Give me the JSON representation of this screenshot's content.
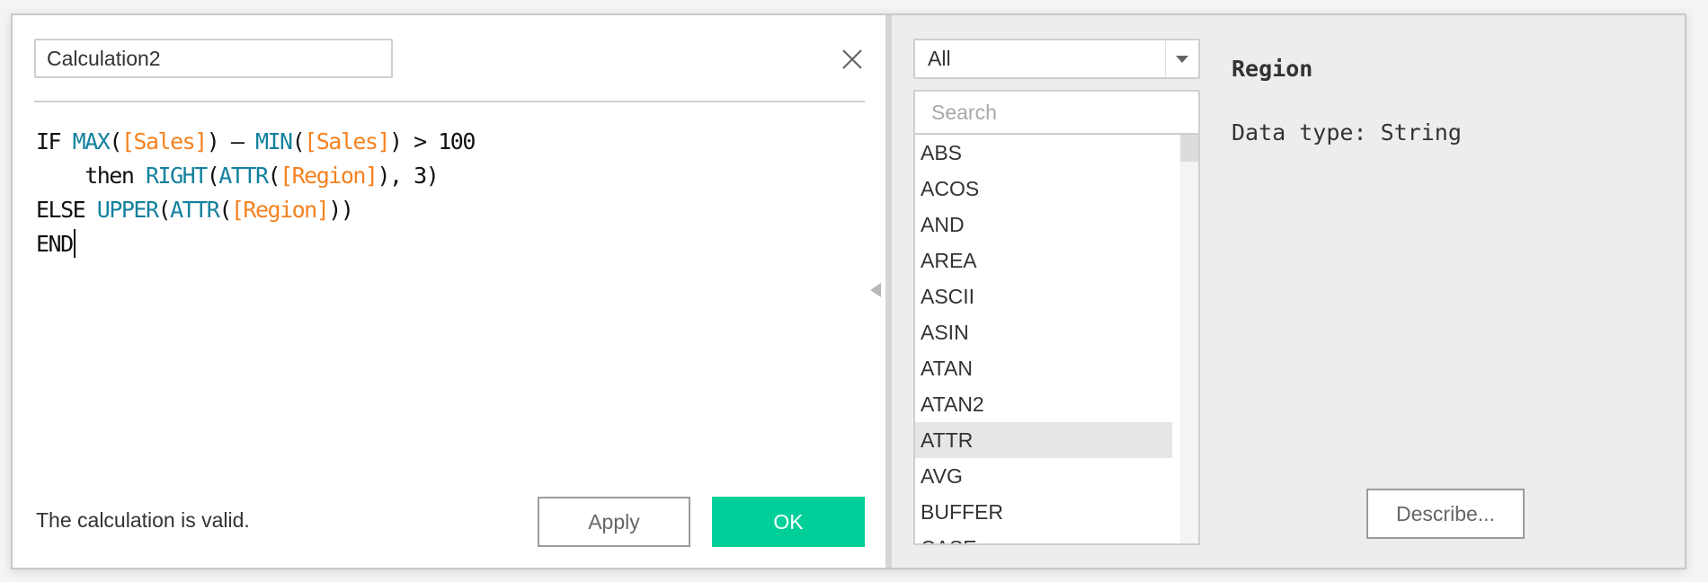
{
  "calc_editor": {
    "name_value": "Calculation2",
    "close_icon": "close-icon",
    "formula_lines": [
      [
        {
          "type": "kw",
          "text": "IF "
        },
        {
          "type": "fn",
          "text": "MAX"
        },
        {
          "type": "kw",
          "text": "("
        },
        {
          "type": "fld",
          "text": "[Sales]"
        },
        {
          "type": "kw",
          "text": ") – "
        },
        {
          "type": "fn",
          "text": "MIN"
        },
        {
          "type": "kw",
          "text": "("
        },
        {
          "type": "fld",
          "text": "[Sales]"
        },
        {
          "type": "kw",
          "text": ") > 100"
        }
      ],
      [
        {
          "type": "kw",
          "text": "    then "
        },
        {
          "type": "fn",
          "text": "RIGHT"
        },
        {
          "type": "kw",
          "text": "("
        },
        {
          "type": "fn",
          "text": "ATTR"
        },
        {
          "type": "kw",
          "text": "("
        },
        {
          "type": "fld",
          "text": "[Region]"
        },
        {
          "type": "kw",
          "text": "), 3)"
        }
      ],
      [
        {
          "type": "kw",
          "text": "ELSE "
        },
        {
          "type": "fn",
          "text": "UPPER"
        },
        {
          "type": "kw",
          "text": "("
        },
        {
          "type": "fn",
          "text": "ATTR"
        },
        {
          "type": "kw",
          "text": "("
        },
        {
          "type": "fld",
          "text": "[Region]"
        },
        {
          "type": "kw",
          "text": "))"
        }
      ],
      [
        {
          "type": "kw",
          "text": "END"
        }
      ]
    ],
    "status_text": "The calculation is valid.",
    "apply_label": "Apply",
    "ok_label": "OK",
    "colors": {
      "function": "#13819e",
      "field": "#f58220",
      "keyword": "#111111",
      "ok_button": "#00cf99"
    }
  },
  "function_panel": {
    "category_selected": "All",
    "search_placeholder": "Search",
    "search_value": "",
    "functions": [
      "ABS",
      "ACOS",
      "AND",
      "AREA",
      "ASCII",
      "ASIN",
      "ATAN",
      "ATAN2",
      "ATTR",
      "AVG",
      "BUFFER",
      "CASE"
    ],
    "selected_function": "ATTR",
    "info_title": "Region",
    "info_datatype": "Data type: String",
    "describe_label": "Describe..."
  }
}
